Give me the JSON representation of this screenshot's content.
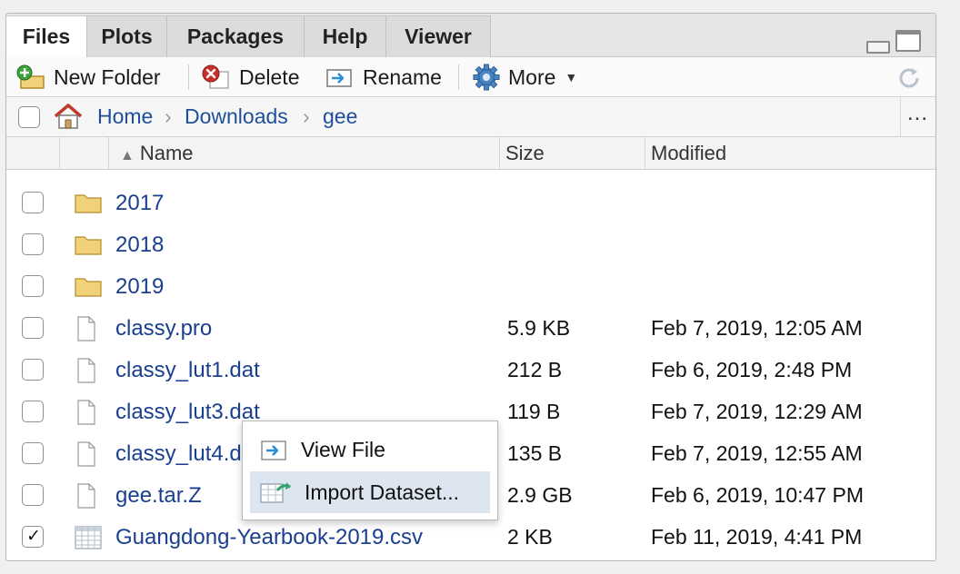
{
  "tabs": [
    {
      "label": "Files",
      "active": true
    },
    {
      "label": "Plots",
      "active": false
    },
    {
      "label": "Packages",
      "active": false
    },
    {
      "label": "Help",
      "active": false
    },
    {
      "label": "Viewer",
      "active": false
    }
  ],
  "toolbar": {
    "new_folder": "New Folder",
    "delete": "Delete",
    "rename": "Rename",
    "more": "More"
  },
  "breadcrumb": {
    "home": "Home",
    "items": [
      "Downloads",
      "gee"
    ],
    "more": "..."
  },
  "columns": {
    "name": "Name",
    "size": "Size",
    "modified": "Modified"
  },
  "files": [
    {
      "name": "2017",
      "type": "folder",
      "size": "",
      "modified": "",
      "checked": false
    },
    {
      "name": "2018",
      "type": "folder",
      "size": "",
      "modified": "",
      "checked": false
    },
    {
      "name": "2019",
      "type": "folder",
      "size": "",
      "modified": "",
      "checked": false
    },
    {
      "name": "classy.pro",
      "type": "file",
      "size": "5.9 KB",
      "modified": "Feb 7, 2019, 12:05 AM",
      "checked": false
    },
    {
      "name": "classy_lut1.dat",
      "type": "file",
      "size": "212 B",
      "modified": "Feb 6, 2019, 2:48 PM",
      "checked": false
    },
    {
      "name": "classy_lut3.dat",
      "type": "file",
      "size": "119 B",
      "modified": "Feb 7, 2019, 12:29 AM",
      "checked": false
    },
    {
      "name": "classy_lut4.dat",
      "type": "file",
      "size": "135 B",
      "modified": "Feb 7, 2019, 12:55 AM",
      "checked": false
    },
    {
      "name": "gee.tar.Z",
      "type": "file",
      "size": "2.9 GB",
      "modified": "Feb 6, 2019, 10:47 PM",
      "checked": false
    },
    {
      "name": "Guangdong-Yearbook-2019.csv",
      "type": "csv",
      "size": "2 KB",
      "modified": "Feb 11, 2019, 4:41 PM",
      "checked": true
    }
  ],
  "context_menu": {
    "items": [
      {
        "label": "View File",
        "highlighted": false
      },
      {
        "label": "Import Dataset...",
        "highlighted": true
      }
    ]
  },
  "colors": {
    "link": "#1a3f8f",
    "menu_highlight": "#dde5f0",
    "folder": "#f1d27a"
  }
}
